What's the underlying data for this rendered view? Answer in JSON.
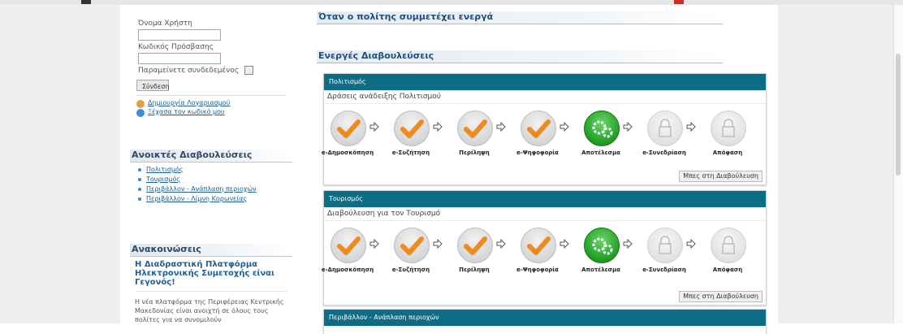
{
  "login": {
    "username_label": "Όνομα Χρήστη",
    "username_value": "",
    "password_label": "Κωδικός Πρόσβασης",
    "password_value": "",
    "remember_label": "Παραμείνετε συνδεδεμένος",
    "login_button": "Σύνδεση",
    "create_account_link": "Δημιουργία Λογαριασμού",
    "forgot_password_link": "Ξέχασα τον κωδικό μου"
  },
  "open_consultations": {
    "heading": "Ανοικτές Διαβουλεύσεις",
    "items": [
      {
        "label": "Πολιτισμός"
      },
      {
        "label": "Τουρισμός"
      },
      {
        "label": "Περιβάλλον - Ανάπλαση περιοχών"
      },
      {
        "label": "Περιβάλλον - Λίμνη Κορωνείας"
      }
    ]
  },
  "announcements": {
    "heading": "Ανακοινώσεις",
    "title": "Η Διαδραστική Πλατφόρμα Ηλεκτρονικής Συμετοχής είναι Γεγονός!",
    "body": "Η νέα πλατφόρμα της Περιφέρειας Κεντρικής Μακεδονίας είναι ανοιχτή σε όλους τους πολίτες για να συνομιλούν"
  },
  "main": {
    "citizen_heading": "Όταν ο πολίτης συμμετέχει ενεργά",
    "active_heading": "Ενεργές Διαβουλεύσεις",
    "step_labels": [
      "e-Δημοσκόπηση",
      "e-Συζήτηση",
      "Περίληψη",
      "e-Ψηφοφορία",
      "Αποτέλεσμα",
      "e-Συνεδρίαση",
      "Απόφαση"
    ],
    "step_states": [
      "done",
      "done",
      "done",
      "done",
      "active",
      "locked",
      "locked"
    ],
    "go_button": "Μπες στη Διαβούλευση",
    "panels": [
      {
        "title": "Πολιτισμός",
        "subtitle": "Δράσεις ανάδειξης Πολιτισμού"
      },
      {
        "title": "Τουρισμός",
        "subtitle": "Διαβούλευση για τον Τουρισμό"
      },
      {
        "title": "Περιβάλλον - Ανάπλαση περιοχών"
      }
    ]
  },
  "colors": {
    "panel_header": "#0e6c85",
    "link": "#1a5e94",
    "check_orange": "#f08a1c",
    "active_green": "#1f9d1f"
  }
}
